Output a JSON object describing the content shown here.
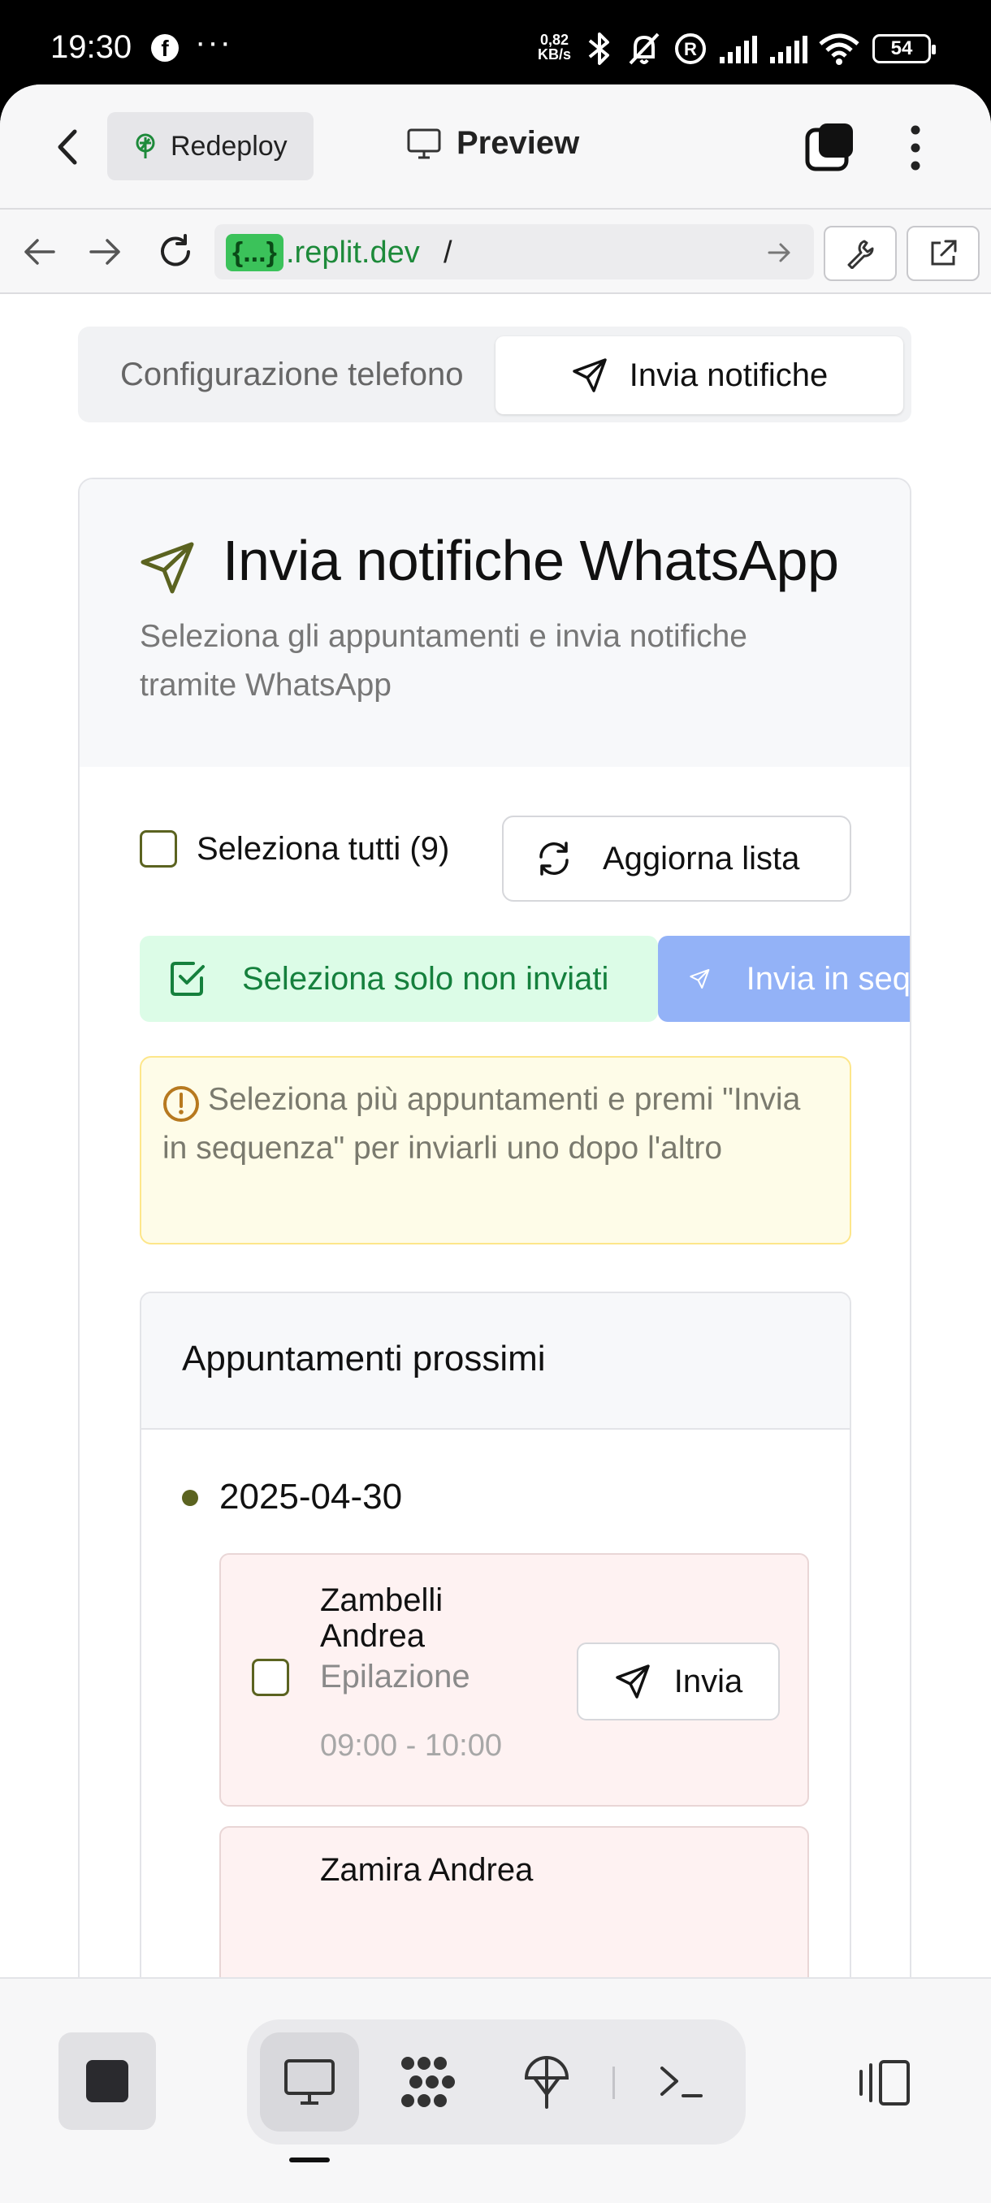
{
  "status_bar": {
    "time": "19:30",
    "speed_value": "0,82",
    "speed_unit": "KB/s",
    "battery": "54",
    "icons": [
      "facebook-icon",
      "more-dots-icon",
      "bluetooth-icon",
      "mute-bell-icon",
      "registered-icon",
      "signal-icon",
      "signal-icon",
      "wifi-icon",
      "battery-icon"
    ]
  },
  "topbar": {
    "redeploy_label": "Redeploy",
    "preview_label": "Preview"
  },
  "urlbar": {
    "badge": "{...}",
    "host": ".replit.dev",
    "path": "/"
  },
  "tabs": {
    "config_label": "Configurazione telefono",
    "send_label": "Invia notifiche"
  },
  "card": {
    "title": "Invia notifiche WhatsApp",
    "description": "Seleziona gli appuntamenti e invia notifiche tramite WhatsApp",
    "select_all_label": "Seleziona tutti (9)",
    "refresh_label": "Aggiorna lista",
    "only_unsent_label": "Seleziona solo non inviati",
    "sequence_label": "Invia in sequenza",
    "notice": "Seleziona più appuntamenti e premi \"Invia in sequenza\" per inviarli uno dopo l'altro"
  },
  "appointments": {
    "title": "Appuntamenti prossimi",
    "date": "2025-04-30",
    "items": [
      {
        "name": "Zambelli Andrea",
        "service": "Epilazione",
        "time": "09:00 - 10:00",
        "send_label": "Invia"
      },
      {
        "name": "Zamira Andrea"
      }
    ]
  },
  "colors": {
    "accent_olive": "#5b6320",
    "success_bg": "#dcfce7",
    "success_text": "#15803d",
    "primary_disabled": "#93b2f7",
    "notice_bg": "#fefce8",
    "appointment_bg": "#fef2f2"
  }
}
